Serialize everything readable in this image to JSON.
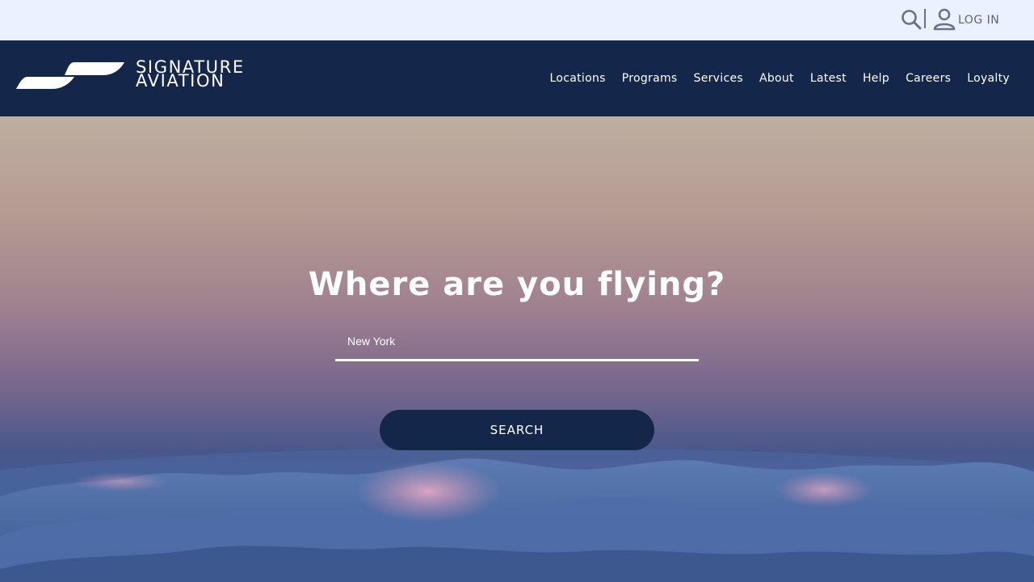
{
  "utility": {
    "search_icon": "search-icon",
    "user_icon": "user-icon",
    "login_label": "LOG IN"
  },
  "header": {
    "logo": {
      "line1": "SIGNATURE",
      "line2": "AVIATION"
    },
    "nav": [
      {
        "label": "Locations"
      },
      {
        "label": "Programs"
      },
      {
        "label": "Services"
      },
      {
        "label": "About"
      },
      {
        "label": "Latest"
      },
      {
        "label": "Help"
      },
      {
        "label": "Careers"
      },
      {
        "label": "Loyalty"
      }
    ]
  },
  "hero": {
    "title": "Where are you flying?",
    "location_value": "New York",
    "search_label": "SEARCH"
  },
  "colors": {
    "navy": "#14264a",
    "utility_bg": "#ebf2ff",
    "icon_gray": "#6b7186",
    "white": "#ffffff"
  }
}
